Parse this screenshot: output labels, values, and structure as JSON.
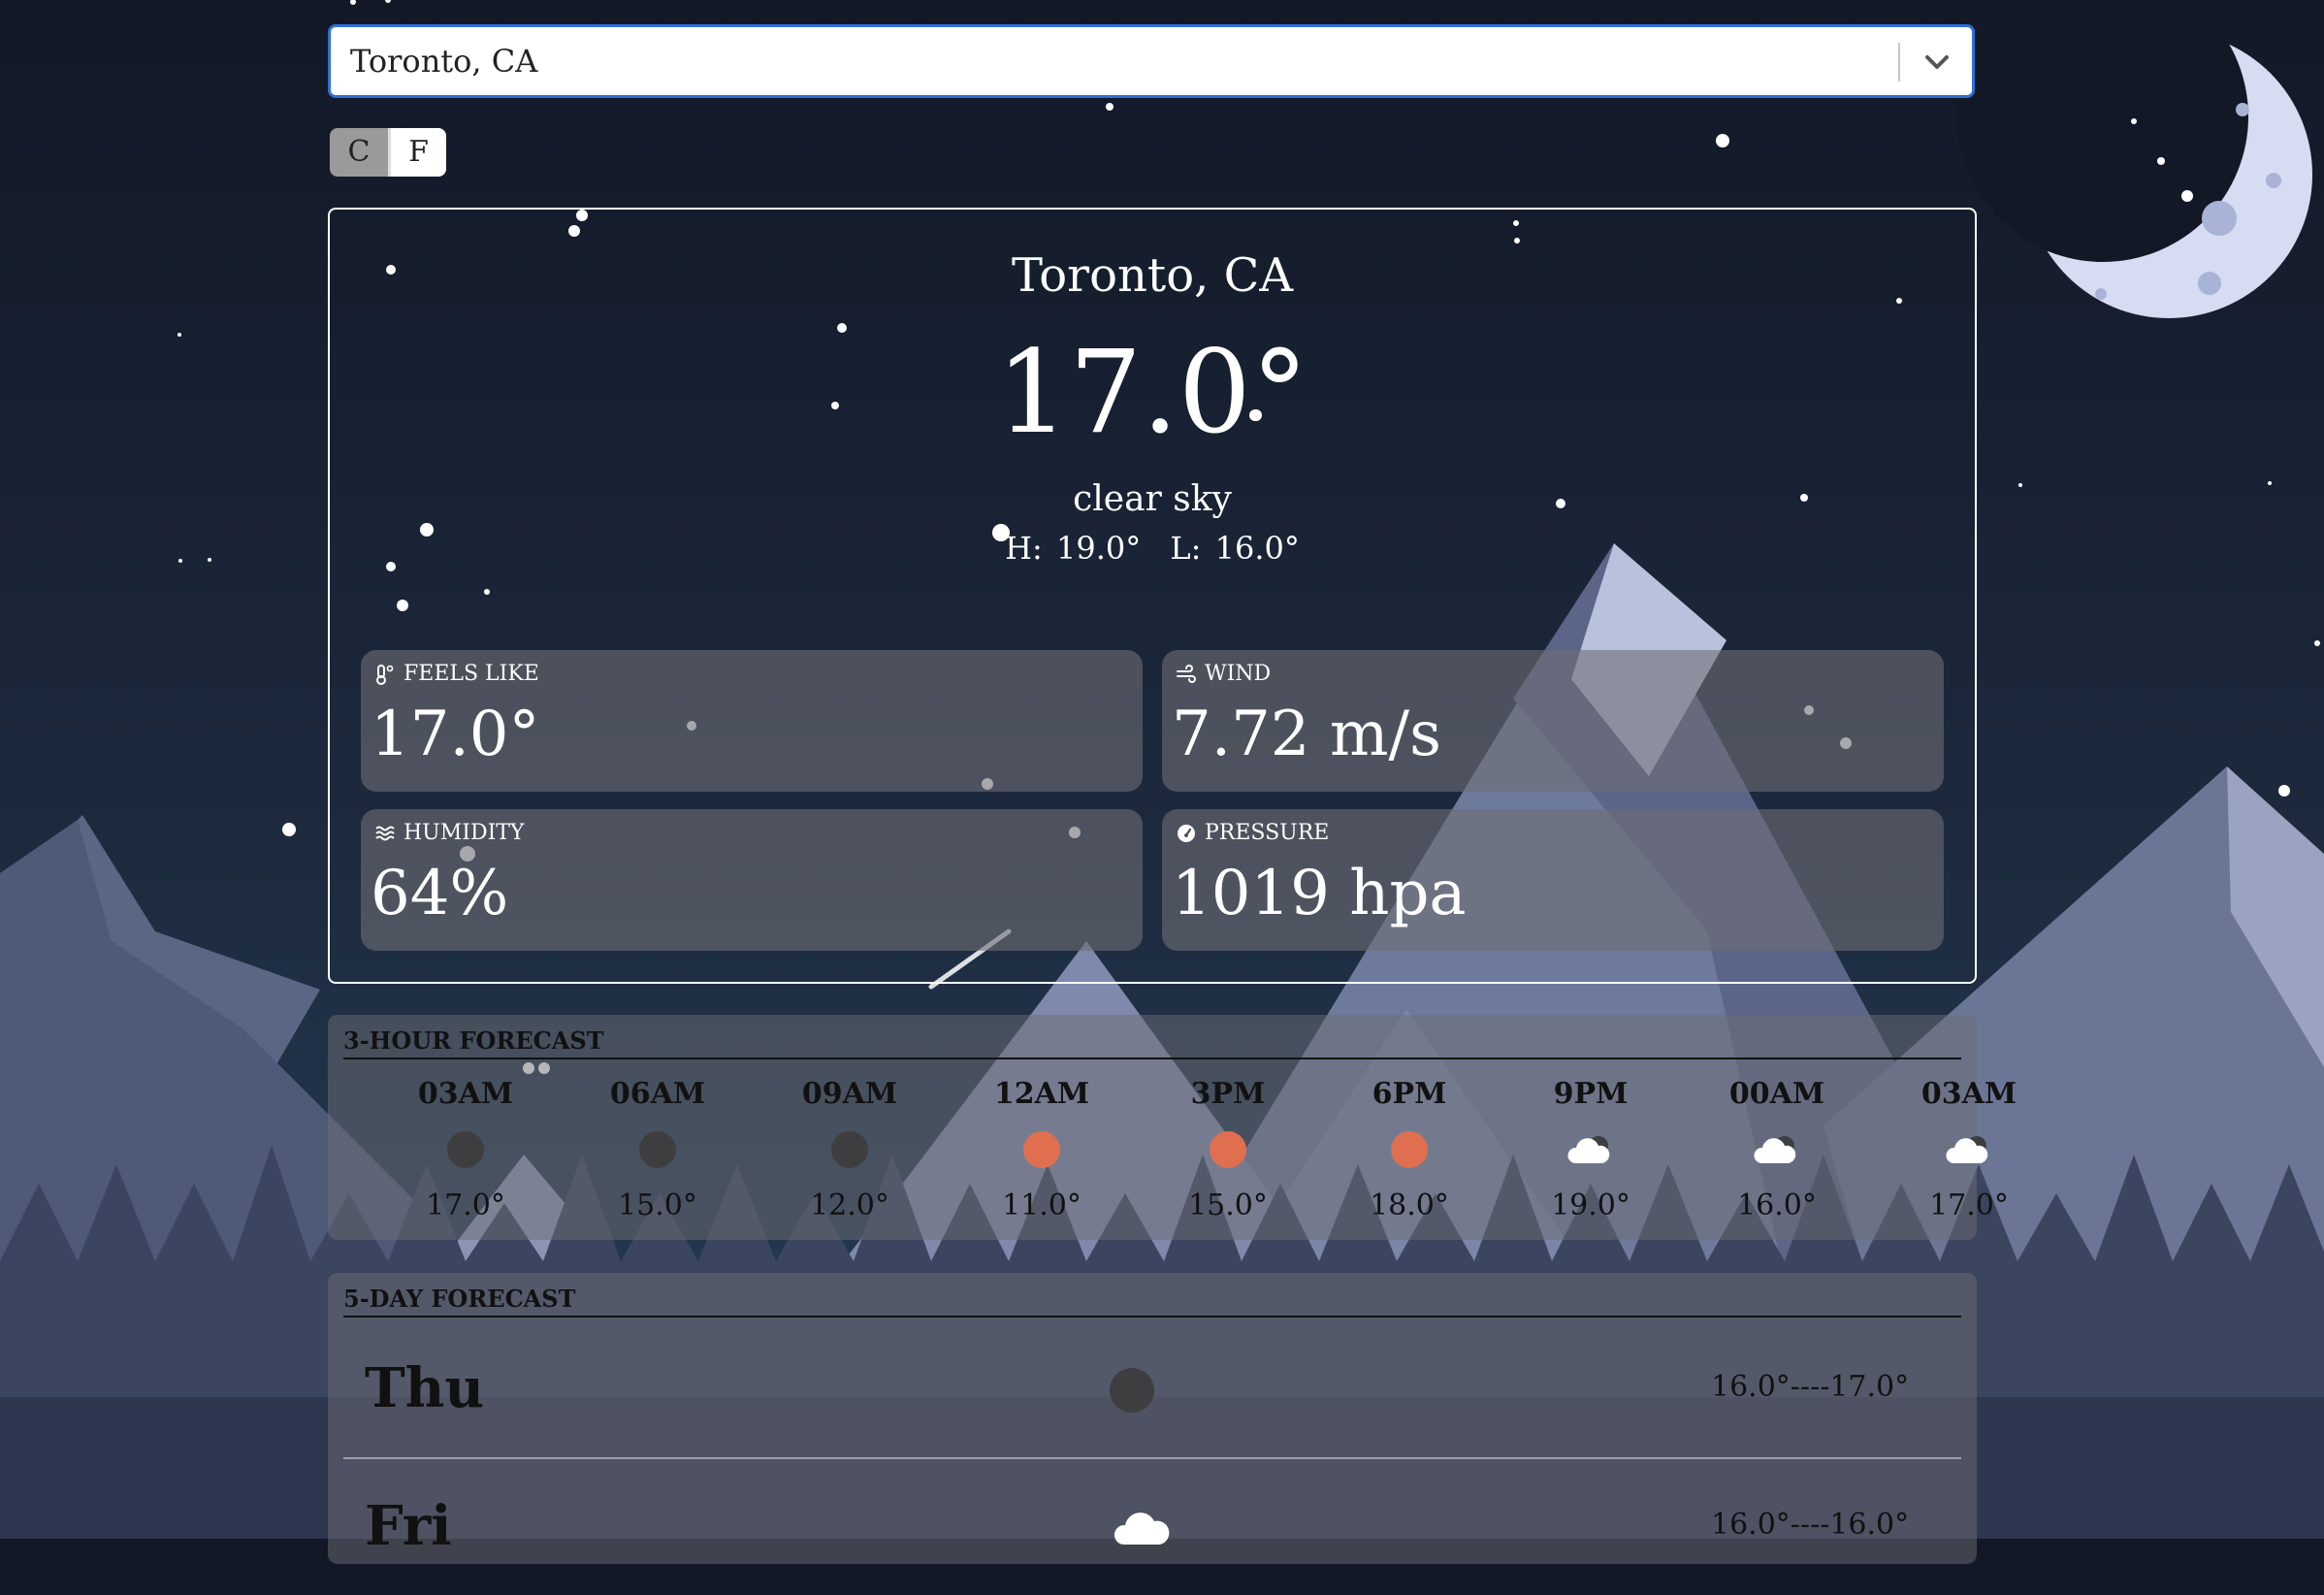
{
  "location_select": {
    "value": "Toronto, CA"
  },
  "units": {
    "celsius": "C",
    "fahrenheit": "F",
    "active": "C"
  },
  "current": {
    "city": "Toronto, CA",
    "temperature": "17.0°",
    "description": "clear sky",
    "high": "H: 19.0°",
    "low": "L: 16.0°"
  },
  "stats": {
    "feels_like": {
      "label": "FEELS LIKE",
      "value": "17.0°",
      "icon": "thermometer-icon"
    },
    "wind": {
      "label": "WIND",
      "value": "7.72 m/s",
      "icon": "wind-icon"
    },
    "humidity": {
      "label": "HUMIDITY",
      "value": "64%",
      "icon": "waves-icon"
    },
    "pressure": {
      "label": "PRESSURE",
      "value": "1019 hpa",
      "icon": "gauge-icon"
    }
  },
  "hourly": {
    "title": "3-HOUR FORECAST",
    "items": [
      {
        "time": "03AM",
        "temp": "17.0°",
        "icon": "moon"
      },
      {
        "time": "06AM",
        "temp": "15.0°",
        "icon": "moon"
      },
      {
        "time": "09AM",
        "temp": "12.0°",
        "icon": "moon"
      },
      {
        "time": "12AM",
        "temp": "11.0°",
        "icon": "sun"
      },
      {
        "time": "3PM",
        "temp": "15.0°",
        "icon": "sun"
      },
      {
        "time": "6PM",
        "temp": "18.0°",
        "icon": "sun"
      },
      {
        "time": "9PM",
        "temp": "19.0°",
        "icon": "cloud-night"
      },
      {
        "time": "00AM",
        "temp": "16.0°",
        "icon": "cloud-night"
      },
      {
        "time": "03AM",
        "temp": "17.0°",
        "icon": "cloud-night"
      }
    ]
  },
  "daily": {
    "title": "5-DAY FORECAST",
    "items": [
      {
        "day": "Thu",
        "range": "16.0°----17.0°",
        "icon": "moon"
      },
      {
        "day": "Fri",
        "range": "16.0°----16.0°",
        "icon": "cloud"
      }
    ]
  },
  "colors": {
    "background": "#121826",
    "select_border": "#2f6fd6",
    "sun": "#e06f4f",
    "moon_dot": "#3e3e40",
    "mountain": "#6e7a9c"
  }
}
